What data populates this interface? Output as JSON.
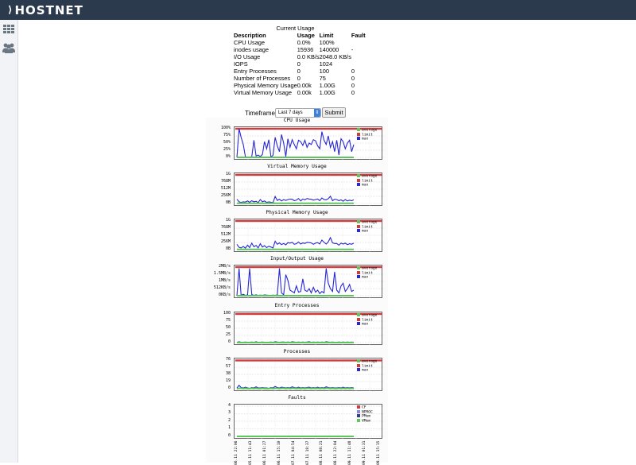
{
  "header": {
    "logo_text": "HOSTNET",
    "logo_mark": "⟩"
  },
  "sidebar": {
    "items": [
      {
        "icon": "grid-icon"
      },
      {
        "icon": "users-icon"
      }
    ]
  },
  "usage": {
    "title": "Current Usage",
    "headers": [
      "Description",
      "Usage",
      "Limit",
      "Fault"
    ],
    "rows": [
      [
        "CPU Usage",
        "0.0%",
        "100%",
        ""
      ],
      [
        "inodes usage",
        "15936",
        "140000",
        "-"
      ],
      [
        "I/O Usage",
        "0.0 KB/s",
        "2048.0 KB/s",
        ""
      ],
      [
        "IOPS",
        "0",
        "1024",
        ""
      ],
      [
        "Entry Processes",
        "0",
        "100",
        "0"
      ],
      [
        "Number of Processes",
        "0",
        "75",
        "0"
      ],
      [
        "Physical Memory Usage",
        "0.00k",
        "1.00G",
        "0"
      ],
      [
        "Virtual Memory Usage",
        "0.00k",
        "1.00G",
        "0"
      ]
    ]
  },
  "timeframe": {
    "label": "Timeframe:",
    "selected": "Last 7 days",
    "submit": "Submit"
  },
  "colors": {
    "topbar": "#2b3a4c",
    "average": "#5cc85c",
    "limit": "#d43a3a",
    "max": "#2727d6"
  },
  "chart_data": [
    {
      "type": "line",
      "title": "CPU Usage",
      "yticks": [
        "100%",
        "75%",
        "50%",
        "25%",
        "0%"
      ],
      "ylim": [
        0,
        100
      ],
      "limit": 100,
      "legend": [
        "average",
        "limit",
        "max"
      ],
      "series": [
        {
          "name": "max",
          "values": [
            0,
            100,
            70,
            45,
            2,
            1,
            1,
            2,
            60,
            5,
            8,
            3,
            10,
            55,
            30,
            62,
            2,
            7,
            70,
            40,
            20,
            80,
            50,
            3,
            65,
            35,
            62,
            45,
            30,
            60,
            55,
            42,
            60,
            35,
            50,
            45,
            62,
            58,
            40,
            30,
            90,
            60,
            45,
            75,
            35,
            55,
            20,
            60,
            8,
            65,
            55,
            30,
            50,
            60,
            20,
            45
          ]
        },
        {
          "name": "average",
          "values": [
            0,
            0,
            0,
            0,
            0,
            0,
            0,
            0,
            0,
            0,
            0,
            0,
            0,
            0,
            0,
            0,
            0,
            0,
            0,
            0,
            0,
            0,
            0,
            0,
            0,
            0,
            0,
            0,
            0,
            0,
            0,
            0,
            0,
            0,
            0,
            0,
            0,
            0,
            0,
            0,
            0,
            0,
            0,
            0,
            0,
            0,
            0,
            0,
            0,
            0,
            0,
            0,
            0,
            0,
            0,
            0
          ]
        }
      ]
    },
    {
      "type": "line",
      "title": "Virtual Memory Usage",
      "yticks": [
        "1G",
        "768M",
        "512M",
        "256M",
        "0B"
      ],
      "ylim": [
        0,
        1024
      ],
      "limit": 1024,
      "legend": [
        "average",
        "limit",
        "max"
      ],
      "series": [
        {
          "name": "max",
          "values": [
            150,
            60,
            40,
            60,
            50,
            90,
            40,
            100,
            60,
            80,
            30,
            140,
            60,
            90,
            40,
            60,
            45,
            30,
            250,
            110,
            150,
            90,
            140,
            110,
            140,
            160,
            150,
            100,
            120,
            180,
            90,
            160,
            130,
            180,
            160,
            150,
            120,
            140,
            160,
            100,
            200,
            140,
            130,
            170,
            260,
            100,
            150,
            140,
            100,
            130,
            80,
            140,
            90,
            120,
            100,
            130
          ]
        },
        {
          "name": "average",
          "values": [
            5,
            5,
            5,
            5,
            5,
            5,
            5,
            5,
            5,
            5,
            5,
            5,
            5,
            5,
            5,
            5,
            5,
            5,
            5,
            5,
            5,
            5,
            5,
            5,
            5,
            5,
            5,
            5,
            5,
            5,
            5,
            5,
            5,
            5,
            5,
            5,
            5,
            5,
            5,
            5,
            5,
            5,
            5,
            5,
            5,
            5,
            5,
            5,
            5,
            5,
            5,
            5,
            5,
            5,
            5,
            5
          ]
        }
      ]
    },
    {
      "type": "line",
      "title": "Physical Memory Usage",
      "yticks": [
        "1G",
        "768M",
        "512M",
        "256M",
        "0B"
      ],
      "ylim": [
        0,
        1024
      ],
      "limit": 1024,
      "legend": [
        "average",
        "limit",
        "max"
      ],
      "series": [
        {
          "name": "max",
          "values": [
            190,
            80,
            60,
            110,
            50,
            160,
            70,
            230,
            100,
            150,
            60,
            210,
            90,
            140,
            70,
            120,
            90,
            60,
            300,
            190,
            240,
            180,
            220,
            170,
            250,
            230,
            260,
            190,
            210,
            270,
            200,
            240,
            220,
            260,
            250,
            240,
            190,
            230,
            250,
            200,
            340,
            260,
            200,
            280,
            430,
            240,
            220,
            220,
            160,
            230,
            200,
            230,
            180,
            210,
            190,
            230
          ]
        },
        {
          "name": "average",
          "values": [
            5,
            5,
            5,
            5,
            5,
            5,
            5,
            5,
            5,
            5,
            5,
            5,
            5,
            5,
            5,
            5,
            5,
            5,
            5,
            5,
            5,
            5,
            5,
            5,
            5,
            5,
            5,
            5,
            5,
            5,
            5,
            5,
            5,
            5,
            5,
            5,
            5,
            5,
            5,
            5,
            5,
            5,
            5,
            5,
            5,
            5,
            5,
            5,
            5,
            5,
            5,
            5,
            5,
            5,
            5,
            5
          ]
        }
      ]
    },
    {
      "type": "line",
      "title": "Input/Output Usage",
      "yticks": [
        "2MB/s",
        "1.5MB/s",
        "1MB/s",
        "512KB/s",
        "0KB/s"
      ],
      "ylim": [
        0,
        2048
      ],
      "limit": 2048,
      "legend": [
        "average",
        "limit",
        "max"
      ],
      "series": [
        {
          "name": "max",
          "values": [
            0,
            1950,
            20,
            100,
            20,
            60,
            1950,
            80,
            30,
            60,
            20,
            40,
            30,
            50,
            40,
            30,
            20,
            40,
            30,
            50,
            1950,
            200,
            60,
            1500,
            1100,
            400,
            300,
            200,
            700,
            250,
            300,
            1200,
            400,
            300,
            500,
            200,
            600,
            250,
            400,
            150,
            300,
            200,
            1950,
            900,
            500,
            300,
            1700,
            400,
            200,
            700,
            900,
            300,
            500,
            800,
            300,
            400
          ]
        },
        {
          "name": "average",
          "values": [
            0,
            0,
            0,
            0,
            0,
            0,
            0,
            0,
            0,
            0,
            0,
            0,
            0,
            0,
            0,
            0,
            0,
            0,
            0,
            0,
            0,
            0,
            0,
            0,
            0,
            0,
            0,
            0,
            0,
            0,
            0,
            0,
            0,
            0,
            0,
            0,
            0,
            0,
            0,
            0,
            0,
            0,
            0,
            0,
            0,
            0,
            0,
            0,
            0,
            0,
            0,
            0,
            0,
            0,
            0,
            0
          ]
        }
      ]
    },
    {
      "type": "line",
      "title": "Entry Processes",
      "yticks": [
        "100",
        "75",
        "50",
        "25",
        "0"
      ],
      "ylim": [
        0,
        100
      ],
      "limit": 100,
      "legend": [
        "average",
        "limit",
        "max"
      ],
      "series": [
        {
          "name": "max",
          "values": [
            1,
            3,
            1,
            1,
            2,
            1,
            1,
            2,
            1,
            3,
            1,
            1,
            2,
            1,
            1,
            1,
            2,
            1,
            3,
            2,
            1,
            2,
            2,
            1,
            2,
            1,
            3,
            2,
            1,
            2,
            1,
            2,
            1,
            2,
            3,
            1,
            2,
            1,
            2,
            1,
            2,
            1,
            3,
            2,
            1,
            2,
            1,
            1,
            2,
            1,
            2,
            1,
            2,
            1,
            2,
            1
          ]
        },
        {
          "name": "average",
          "values": [
            0,
            0,
            0,
            0,
            0,
            0,
            0,
            0,
            0,
            0,
            0,
            0,
            0,
            0,
            0,
            0,
            0,
            0,
            0,
            0,
            0,
            0,
            0,
            0,
            0,
            0,
            0,
            0,
            0,
            0,
            0,
            0,
            0,
            0,
            0,
            0,
            0,
            0,
            0,
            0,
            0,
            0,
            0,
            0,
            0,
            0,
            0,
            0,
            0,
            0,
            0,
            0,
            0,
            0,
            0,
            0
          ]
        }
      ]
    },
    {
      "type": "line",
      "title": "Processes",
      "yticks": [
        "76",
        "57",
        "38",
        "19",
        "0"
      ],
      "ylim": [
        0,
        76
      ],
      "limit": 75,
      "legend": [
        "average",
        "limit",
        "max"
      ],
      "series": [
        {
          "name": "max",
          "values": [
            2,
            9,
            3,
            2,
            4,
            2,
            1,
            3,
            2,
            5,
            2,
            2,
            3,
            2,
            2,
            1,
            3,
            2,
            6,
            3,
            2,
            4,
            3,
            2,
            3,
            2,
            5,
            3,
            2,
            4,
            2,
            3,
            2,
            3,
            4,
            2,
            3,
            2,
            4,
            2,
            3,
            2,
            5,
            3,
            2,
            3,
            2,
            2,
            3,
            2,
            4,
            2,
            3,
            2,
            3,
            2
          ]
        },
        {
          "name": "average",
          "values": [
            0,
            1,
            1,
            0,
            1,
            0,
            0,
            1,
            0,
            1,
            0,
            0,
            1,
            0,
            0,
            0,
            1,
            0,
            1,
            1,
            0,
            1,
            1,
            0,
            1,
            0,
            1,
            1,
            0,
            1,
            0,
            1,
            0,
            1,
            1,
            0,
            1,
            0,
            1,
            0,
            1,
            0,
            1,
            1,
            0,
            1,
            0,
            0,
            1,
            0,
            1,
            0,
            1,
            0,
            1,
            0
          ]
        }
      ]
    },
    {
      "type": "line",
      "title": "Faults",
      "yticks": [
        "4",
        "3",
        "2",
        "1",
        "0"
      ],
      "ylim": [
        0,
        4
      ],
      "limit": null,
      "legend": [
        "CF",
        "NPROC",
        "PMem",
        "VMem"
      ],
      "x": [
        "06.11 22:06",
        "05.11 11:43",
        "06.11 01:27",
        "06.11 15:10",
        "07.11 04:54",
        "07.11 18:37",
        "08.11 08:21",
        "08.11 22:04",
        "09.11 11:48",
        "09.11 01:31",
        "09.11 15:15"
      ],
      "series": [
        {
          "name": "VMem",
          "values": [
            0,
            0,
            0,
            0,
            0,
            0,
            0,
            0,
            0,
            0,
            0
          ]
        }
      ]
    }
  ]
}
